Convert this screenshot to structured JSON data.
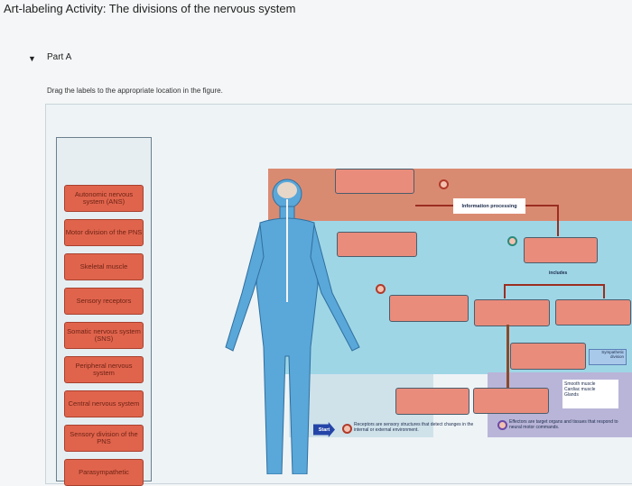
{
  "header": {
    "title": "Art-labeling Activity: The divisions of the nervous system"
  },
  "part": {
    "label": "Part A",
    "instruction": "Drag the labels to the appropriate location in the figure."
  },
  "labels": [
    "Autonomic nervous system (ANS)",
    "Motor division of the PNS",
    "Skeletal muscle",
    "Sensory receptors",
    "Somatic nervous system (SNS)",
    "Peripheral nervous system",
    "Central nervous system",
    "Sensory division of the PNS",
    "Parasympathetic"
  ],
  "figure": {
    "info_processing": "Information processing",
    "includes": "includes",
    "sympathetic": "Sympathetic division",
    "effector_list": [
      "Smooth muscle",
      "Cardiac muscle",
      "Glands"
    ],
    "start": "Start",
    "receptors_text": "Receptors are sensory structures that detect changes in the internal or external environment.",
    "effectors_text": "Effectors are target organs and tissues that respond to neural motor commands."
  }
}
